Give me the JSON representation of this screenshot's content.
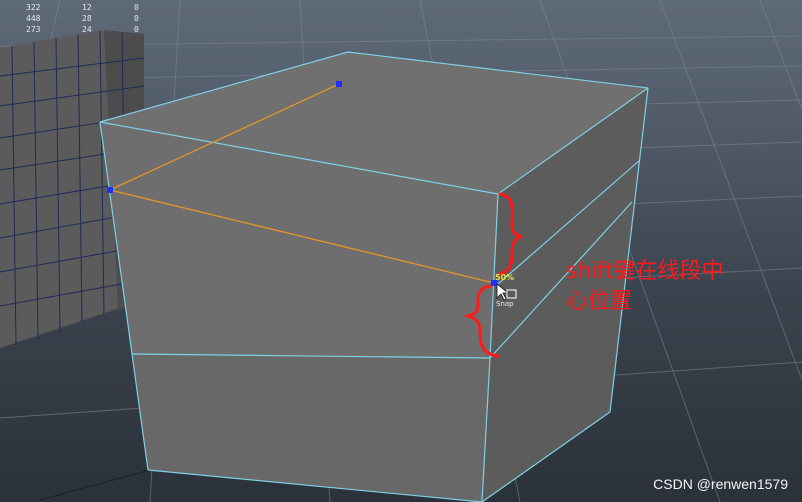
{
  "heads_up_stats": {
    "rows": [
      [
        "322",
        "12",
        "0"
      ],
      [
        "448",
        "28",
        "0"
      ],
      [
        "273",
        "24",
        "0"
      ]
    ]
  },
  "snap": {
    "percent_label": "50%",
    "cursor_label": "Snap"
  },
  "annotation": {
    "line1": "shift键在线段中",
    "line2": "心位置"
  },
  "watermark": "CSDN @renwen1579",
  "colors": {
    "cube_face": "#6f6f6f",
    "cube_side": "#5c5c5c",
    "cube_edge": "#7fd0e6",
    "selected_edge": "#e0912e",
    "vertex": "#1f2fff",
    "annotation": "#ff1a1a",
    "grid_line": "#7d8896"
  }
}
